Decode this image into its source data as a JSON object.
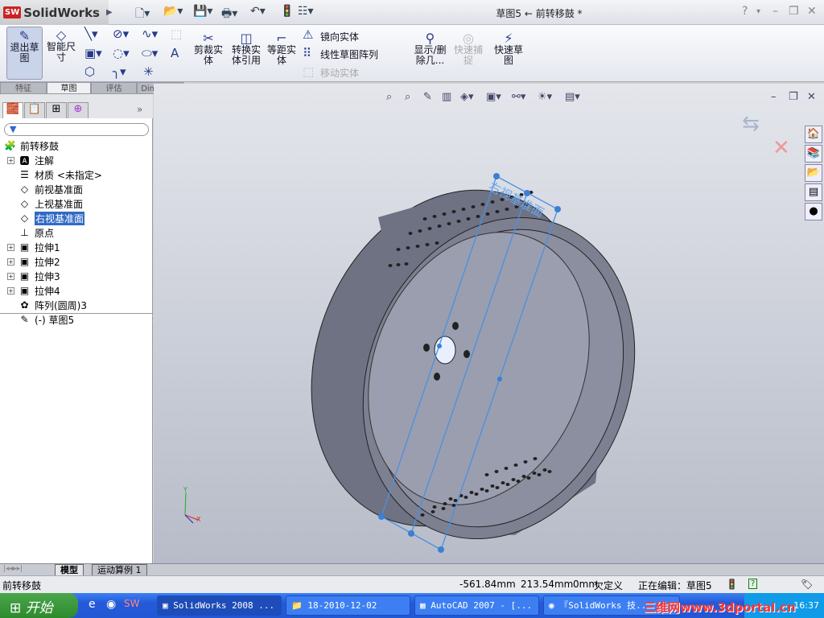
{
  "app": {
    "name": "SolidWorks",
    "doc_title": "草图5 ← 前转移鼓 *",
    "help": "?"
  },
  "quick_access": [
    "new-doc-icon",
    "open-icon",
    "save-icon",
    "print-icon",
    "undo-icon",
    "rebuild-icon",
    "options-icon"
  ],
  "ribbon": {
    "exit_sketch": "退出草图",
    "smart_dim": "智能尺寸",
    "trim": "剪裁实体",
    "convert": "转换实体引用",
    "offset": "等距实体",
    "mirror": "镜向实体",
    "linear_pattern": "线性草图阵列",
    "move": "移动实体",
    "display_delete": "显示/删除几...",
    "quick_snap": "快速捕捉",
    "rapid_sketch": "快速草图"
  },
  "cm_tabs": [
    "特征",
    "草图",
    "评估",
    "DimXpert"
  ],
  "active_cm_tab": "草图",
  "tree": {
    "root": "前转移鼓",
    "items": [
      {
        "label": "注解",
        "expand": true,
        "icon": "annotation-icon"
      },
      {
        "label": "材质 <未指定>",
        "expand": false,
        "icon": "material-icon"
      },
      {
        "label": "前视基准面",
        "expand": false,
        "icon": "plane-icon"
      },
      {
        "label": "上视基准面",
        "expand": false,
        "icon": "plane-icon"
      },
      {
        "label": "右视基准面",
        "expand": false,
        "icon": "plane-icon",
        "selected": true
      },
      {
        "label": "原点",
        "expand": false,
        "icon": "origin-icon"
      },
      {
        "label": "拉伸1",
        "expand": true,
        "icon": "extrude-icon"
      },
      {
        "label": "拉伸2",
        "expand": true,
        "icon": "extrude-icon"
      },
      {
        "label": "拉伸3",
        "expand": true,
        "icon": "extrude-icon"
      },
      {
        "label": "拉伸4",
        "expand": true,
        "icon": "extrude-icon"
      },
      {
        "label": "阵列(圆周)3",
        "expand": false,
        "icon": "circular-pattern-icon"
      },
      {
        "label": "(-) 草图5",
        "expand": false,
        "icon": "sketch-icon"
      }
    ]
  },
  "viewport": {
    "plane_label": "右视基准面",
    "triad": {
      "x": "X",
      "y": "Y"
    }
  },
  "bottom_tabs": [
    "模型",
    "运动算例 1"
  ],
  "status": {
    "doc": "前转移鼓",
    "x": "-561.84mm",
    "y": "213.54mm",
    "z": "0mm",
    "state": "欠定义",
    "editing": "正在编辑：草图5"
  },
  "taskbar": {
    "start": "开始",
    "tasks": [
      "SolidWorks 2008 ...",
      "18-2010-12-02",
      "AutoCAD 2007 - [...",
      "『SolidWorks 技..."
    ],
    "active_task": 0,
    "clock": "16:37",
    "watermark": "三维网www.3dportal.cn"
  },
  "colors": {
    "selection": "#316ac5",
    "sketch": "#4a90e2",
    "taskbar": "#2459d8"
  }
}
